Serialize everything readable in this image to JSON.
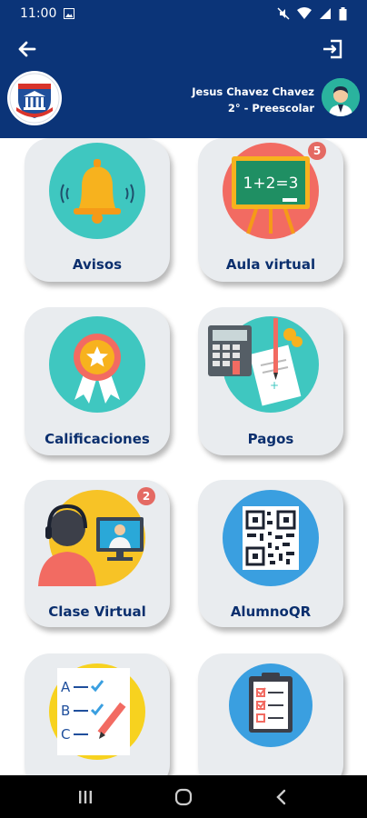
{
  "status_bar": {
    "time": "11:00",
    "icons": [
      "image-icon",
      "mute-icon",
      "wifi-icon",
      "signal-icon",
      "battery-icon"
    ]
  },
  "header": {
    "user_name": "Jesus Chavez Chavez",
    "grade": "2° - Preescolar",
    "background_color": "#0b3478"
  },
  "tiles": [
    {
      "label": "Avisos",
      "icon": "bell-icon",
      "color": "#3fc7c0",
      "badge": ""
    },
    {
      "label": "Aula virtual",
      "icon": "chalkboard-icon",
      "color": "#f26b62",
      "badge": "5",
      "board_text": "1+2=3"
    },
    {
      "label": "Calificaciones",
      "icon": "award-ribbon-icon",
      "color": "#3fc7c0",
      "badge": ""
    },
    {
      "label": "Pagos",
      "icon": "calculator-bills-icon",
      "color": "#3fc7c0",
      "badge": ""
    },
    {
      "label": "Clase Virtual",
      "icon": "video-call-icon",
      "color": "#f7c326",
      "badge": "2"
    },
    {
      "label": "AlumnoQR",
      "icon": "qr-code-icon",
      "color": "#3a9fe0",
      "badge": ""
    },
    {
      "label": "",
      "icon": "test-checklist-icon",
      "color": "#f7d21f",
      "badge": "",
      "test_letters": [
        "A",
        "B",
        "C"
      ]
    },
    {
      "label": "",
      "icon": "clipboard-icon",
      "color": "#3a9fe0",
      "badge": ""
    }
  ],
  "nav_bar": {
    "items": [
      "recents-icon",
      "home-icon",
      "back-nav-icon"
    ]
  }
}
